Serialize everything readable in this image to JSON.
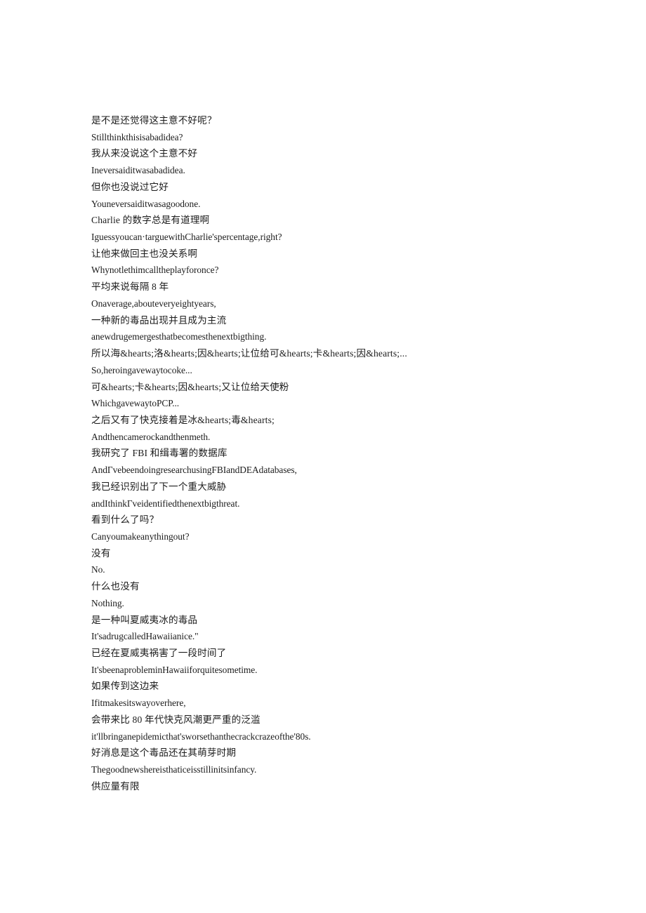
{
  "document": {
    "type": "bilingual-subtitle-transcript",
    "background_color": "#ffffff",
    "text_color": "#1c1c1c",
    "lines": [
      {
        "lang": "cjk",
        "text": "是不是还觉得这主意不好呢？"
      },
      {
        "lang": "latin",
        "text": "Stillthinkthisisabadidea?"
      },
      {
        "lang": "cjk",
        "text": "我从来没说这个主意不好"
      },
      {
        "lang": "latin",
        "text": "Ineversaiditwasabadidea."
      },
      {
        "lang": "cjk",
        "text": "但你也没说过它好"
      },
      {
        "lang": "latin",
        "text": "Youneversaiditwasagoodone."
      },
      {
        "lang": "cjk",
        "text": "Charlie 的数字总是有道理啊"
      },
      {
        "lang": "latin",
        "text": "Iguessyoucan·targuewithCharlie'spercentage,right?"
      },
      {
        "lang": "cjk",
        "text": "让他来做回主也没关系啊"
      },
      {
        "lang": "latin",
        "text": "Whynotlethimcalltheplayforonce?"
      },
      {
        "lang": "cjk",
        "text": "平均来说每隔 8 年"
      },
      {
        "lang": "latin",
        "text": "Onaverage,abouteveryeightyears,"
      },
      {
        "lang": "cjk",
        "text": "一种新的毒品出现并且成为主流"
      },
      {
        "lang": "latin",
        "text": "anewdrugemergesthatbecomesthenextbigthing."
      },
      {
        "lang": "cjk",
        "text": "所以海&hearts;洛&hearts;因&hearts;让位给可&hearts;卡&hearts;因&hearts;..."
      },
      {
        "lang": "latin",
        "text": "So,heroingavewaytocoke..."
      },
      {
        "lang": "cjk",
        "text": "可&hearts;卡&hearts;因&hearts;又让位给天使粉"
      },
      {
        "lang": "latin",
        "text": "WhichgavewaytoPCP..."
      },
      {
        "lang": "cjk",
        "text": "之后又有了快克接着是冰&hearts;毒&hearts;"
      },
      {
        "lang": "latin",
        "text": "Andthencamerockandthenmeth."
      },
      {
        "lang": "cjk",
        "text": "我研究了 FBI 和缉毒署的数据库"
      },
      {
        "lang": "latin",
        "text": "AndΓvebeendoingresearchusingFBIandDEAdatabases,"
      },
      {
        "lang": "cjk",
        "text": "我已经识别出了下一个重大威胁"
      },
      {
        "lang": "latin",
        "text": "andIthinkΓveidentifiedthenextbigthreat."
      },
      {
        "lang": "cjk",
        "text": "看到什么了吗？"
      },
      {
        "lang": "latin",
        "text": "Canyoumakeanythingout?"
      },
      {
        "lang": "cjk",
        "text": "没有"
      },
      {
        "lang": "latin",
        "text": "No."
      },
      {
        "lang": "cjk",
        "text": "什么也没有"
      },
      {
        "lang": "latin",
        "text": "Nothing."
      },
      {
        "lang": "cjk",
        "text": "是一种叫夏威夷冰的毒品"
      },
      {
        "lang": "latin",
        "text": "It'sadrugcalledHawaiianice.\""
      },
      {
        "lang": "cjk",
        "text": "已经在夏威夷祸害了一段时间了"
      },
      {
        "lang": "latin",
        "text": "It'sbeenaprobleminHawaiiforquitesometime."
      },
      {
        "lang": "cjk",
        "text": "如果传到这边来"
      },
      {
        "lang": "latin",
        "text": "Ifitmakesitswayoverhere,"
      },
      {
        "lang": "cjk",
        "text": "会带来比 80 年代快克风潮更严重的泛滥"
      },
      {
        "lang": "latin",
        "text": "it'llbringanepidemicthat'sworsethanthecrackcrazeofthe'80s."
      },
      {
        "lang": "cjk",
        "text": "好消息是这个毒品还在其萌芽时期"
      },
      {
        "lang": "latin",
        "text": "Thegoodnewshereisthaticeisstillinitsinfancy."
      },
      {
        "lang": "cjk",
        "text": "供应量有限"
      }
    ]
  }
}
